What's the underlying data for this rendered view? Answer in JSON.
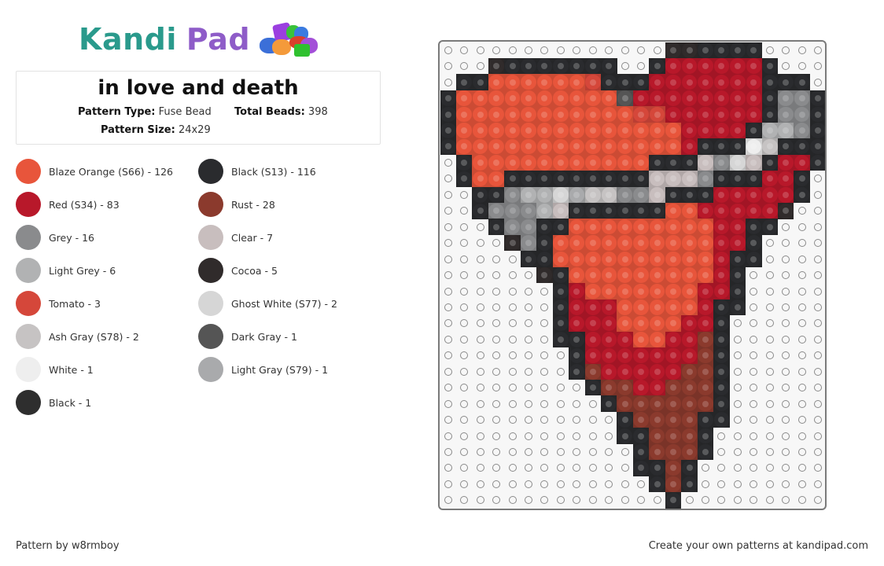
{
  "brand": {
    "part1": "Kandi",
    "part2": "Pad"
  },
  "pattern": {
    "title": "in love and death",
    "type_label": "Pattern Type:",
    "type_value": "Fuse Bead",
    "beads_label": "Total Beads:",
    "beads_value": "398",
    "size_label": "Pattern Size:",
    "size_value": "24x29"
  },
  "legend": {
    "left": [
      {
        "label": "Blaze Orange (S66) - 126",
        "color": "#e8553b"
      },
      {
        "label": "Red (S34) - 83",
        "color": "#b8182a"
      },
      {
        "label": "Grey - 16",
        "color": "#8a8b8d"
      },
      {
        "label": "Light Grey - 6",
        "color": "#b1b2b3"
      },
      {
        "label": "Tomato - 3",
        "color": "#d5473a"
      },
      {
        "label": "Ash Gray (S78) - 2",
        "color": "#c6c3c3"
      },
      {
        "label": "White - 1",
        "color": "#eeeeee"
      },
      {
        "label": "Black - 1",
        "color": "#2e2e2e"
      }
    ],
    "right": [
      {
        "label": "Black (S13) - 116",
        "color": "#2a2b2e"
      },
      {
        "label": "Rust - 28",
        "color": "#8b3a2d"
      },
      {
        "label": "Clear - 7",
        "color": "#c8bebe"
      },
      {
        "label": "Cocoa - 5",
        "color": "#302b2b"
      },
      {
        "label": "Ghost White (S77) - 2",
        "color": "#d6d6d6"
      },
      {
        "label": "Dark Gray - 1",
        "color": "#555555"
      },
      {
        "label": "Light Gray (S79) - 1",
        "color": "#a9aaac"
      }
    ]
  },
  "palette": {
    "O": "#e8553b",
    "R": "#b8182a",
    "K": "#2a2b2e",
    "C": "#302b2b",
    "G": "#8a8b8d",
    "L": "#b1b2b3",
    "T": "#d5473a",
    "A": "#c6c3c3",
    "W": "#eeeeee",
    "B": "#2e2e2e",
    "U": "#8b3a2d",
    "X": "#c8bebe",
    "H": "#d6d6d6",
    "D": "#555555",
    "S": "#a9aaac"
  },
  "grid": {
    "columns": 24,
    "rows": [
      "..............CCKKKK....",
      "...CKKKKKKK..KRRRRRRK...",
      ".KKOOOOOOTKKKRRRRRRRKKK.",
      "KOOOOOOOOOODRRRRRRRRKGGK",
      "KOOOOOOOOOOOTTRRRRRRKGGK",
      "KOOOOOOOOOOOOOORRRRKLLGK",
      "KOOOOOOOOOOOOOORKKKWAKKK",
      ".KOOOOOOOOOOOKKKXGHXKRRK",
      ".KOOKKKKKKKKKXXXGKKKRRK.",
      "..KKGLLHSAAGGXKKKRRRRRK.",
      "..KGGGLXKKKKKKOORRRRRC..",
      "...KGGKKOOOOOOOOORRKK...",
      "....CGKOOOOOOOOOORRK....",
      ".....KKOOOOOOOOOORKK....",
      "......CKOOOOOOOOORK.....",
      ".......KROOOOOOORRK.....",
      ".......KRRROOOOORKK.....",
      ".......KRRROOOORRK......",
      ".......KKRRROORRUK......",
      "........KRRRRRRRUK......",
      "........KURRRRRUUK......",
      ".........KUURRUUUK......",
      "..........KUUUUUUK......",
      "...........KUUUUKK......",
      "...........KKUUUK.......",
      "............KUUUK.......",
      "............KKUK........",
      ".............KUK........",
      "..............K........."
    ]
  },
  "footer": {
    "author": "Pattern by w8rmboy",
    "promo": "Create your own patterns at kandipad.com"
  }
}
